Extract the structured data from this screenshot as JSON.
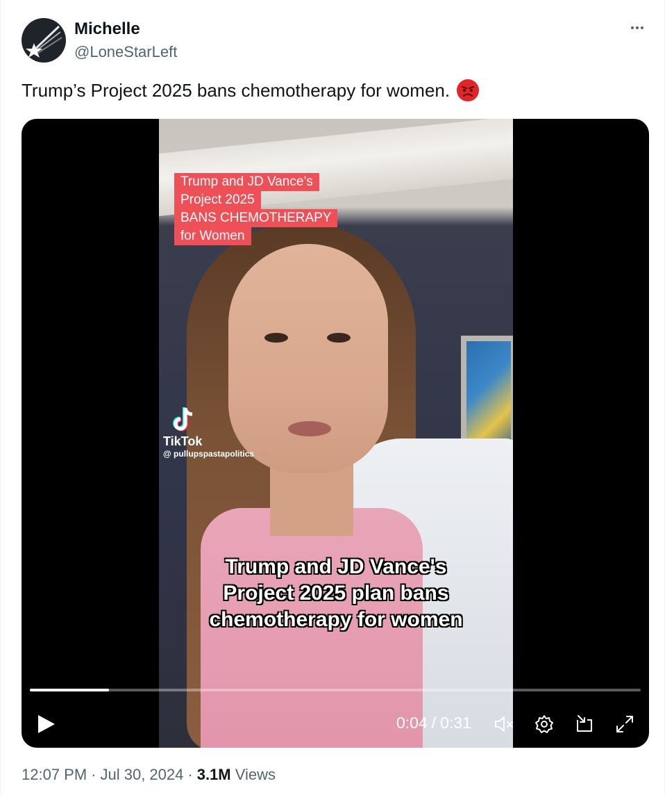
{
  "author": {
    "name": "Michelle",
    "handle": "@LoneStarLeft"
  },
  "tweet": {
    "text": "Trump’s Project 2025 bans chemotherapy for women.",
    "emoji_icon": "angry-face-icon"
  },
  "video": {
    "overlay_top_lines": [
      "Trump and JD Vance’s",
      "Project 2025",
      "BANS CHEMOTHERAPY",
      "for Women"
    ],
    "overlay_top_color": "#ef4f57",
    "watermark_brand": "TikTok",
    "watermark_user": "@ pullupspastapolitics",
    "caption_lines": [
      "Trump and JD Vance's",
      "Project 2025 plan bans",
      "chemotherapy for women"
    ],
    "current_time": "0:04",
    "time_separator": "/",
    "duration": "0:31",
    "progress_fraction": 0.129,
    "controls": {
      "play_icon": "play-icon",
      "mute_icon": "muted-speaker-icon",
      "settings_icon": "gear-icon",
      "dock_icon": "dock-icon",
      "fullscreen_icon": "expand-icon"
    }
  },
  "meta": {
    "time": "12:07 PM",
    "date": "Jul 30, 2024",
    "dot": "·",
    "views_count": "3.1M",
    "views_label": "Views"
  }
}
